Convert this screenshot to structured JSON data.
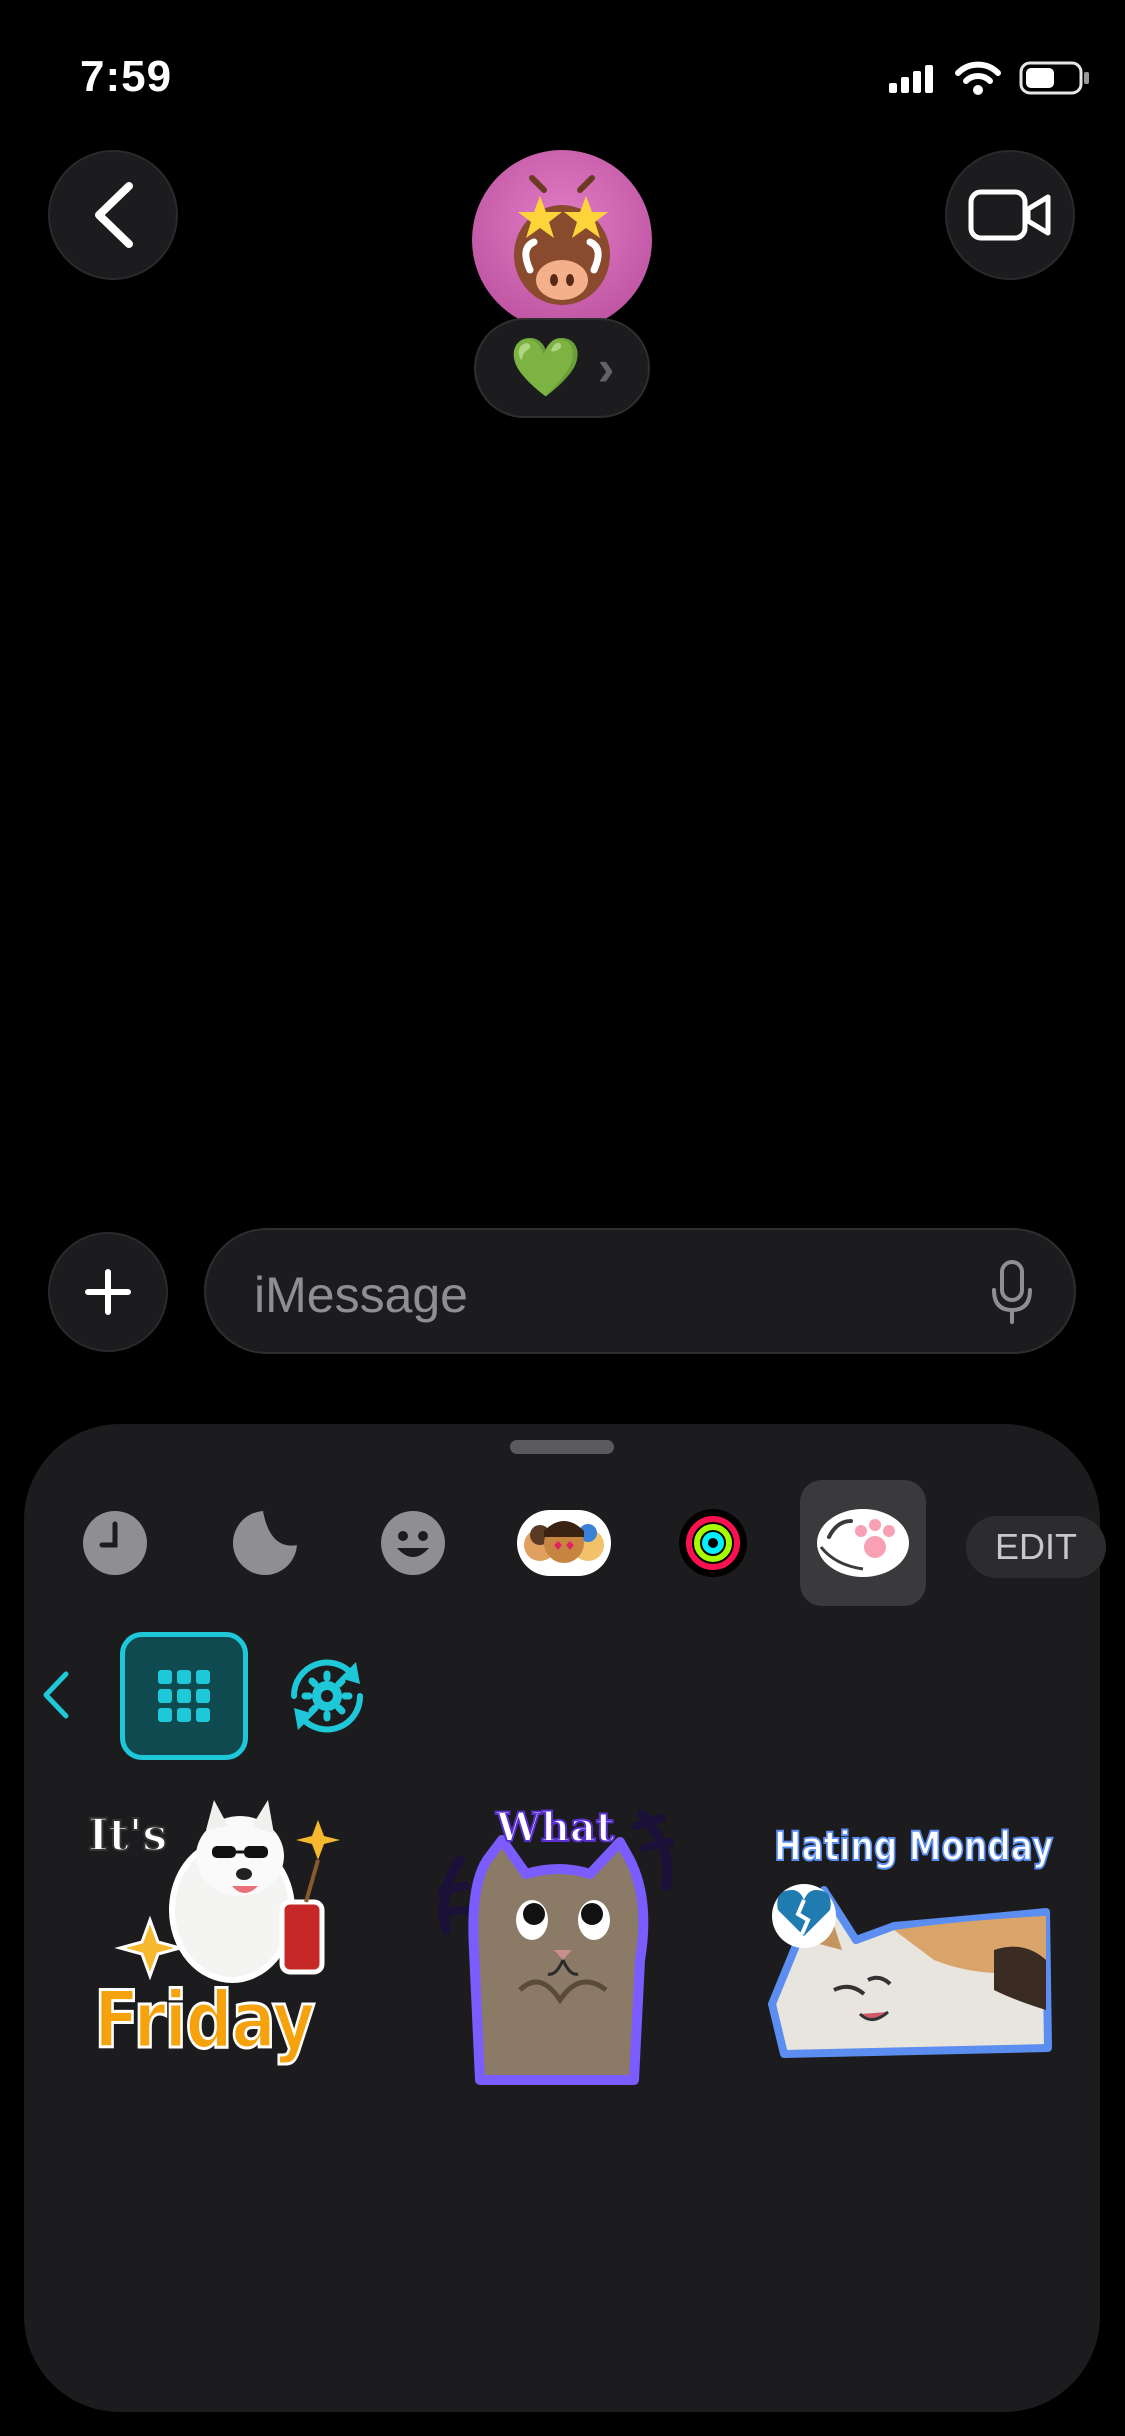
{
  "status_bar": {
    "time": "7:59"
  },
  "header": {
    "avatar_icon": "warthog-memoji-star-eyes",
    "status_emoji": "💚",
    "chevron": "›"
  },
  "composer": {
    "placeholder": "iMessage"
  },
  "app_drawer": {
    "tabs": [
      {
        "icon": "recents-clock-icon"
      },
      {
        "icon": "stickers-icon"
      },
      {
        "icon": "emoji-icon"
      },
      {
        "icon": "memoji-icon"
      },
      {
        "icon": "fitness-rings-icon"
      },
      {
        "icon": "sticker-app-icon",
        "selected": true
      }
    ],
    "edit_label": "EDIT"
  },
  "sticker_app": {
    "accent": "#1fc8d8",
    "stickers": [
      {
        "name": "friday-dog-sticker",
        "top_text": "It's",
        "main_text": "Friday"
      },
      {
        "name": "what-cat-sticker",
        "top_text": "What"
      },
      {
        "name": "hating-monday-sticker",
        "top_text": "Hating Monday"
      }
    ]
  }
}
